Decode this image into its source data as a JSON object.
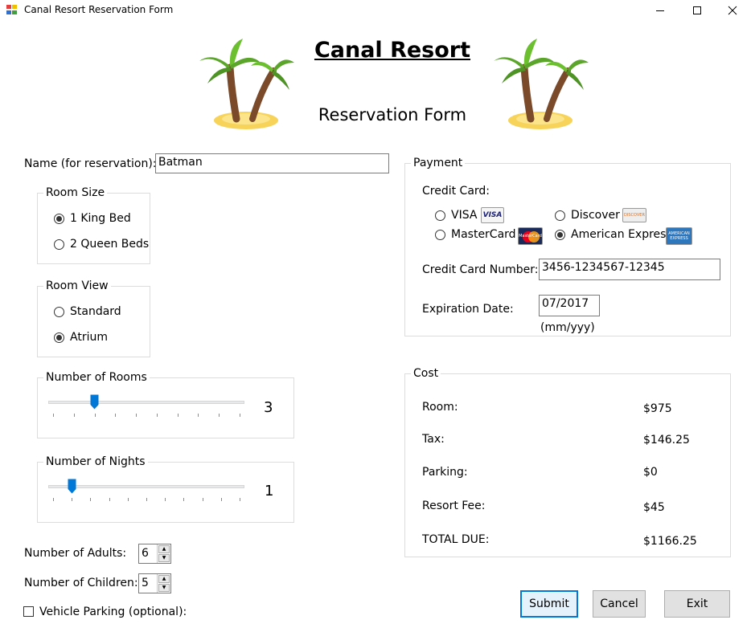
{
  "window": {
    "title": "Canal Resort Reservation Form"
  },
  "header": {
    "title": "Canal Resort",
    "subtitle": "Reservation Form"
  },
  "name_field": {
    "label": "Name (for reservation):",
    "value": "Batman"
  },
  "room_size": {
    "legend": "Room Size",
    "options": [
      {
        "label": "1 King Bed",
        "checked": true
      },
      {
        "label": "2 Queen Beds",
        "checked": false
      }
    ]
  },
  "room_view": {
    "legend": "Room View",
    "options": [
      {
        "label": "Standard",
        "checked": false
      },
      {
        "label": "Atrium",
        "checked": true
      }
    ]
  },
  "rooms": {
    "legend": "Number of Rooms",
    "value": "3",
    "min": 1,
    "max": 10
  },
  "nights": {
    "legend": "Number of Nights",
    "value": "1",
    "min": 0,
    "max": 10
  },
  "adults": {
    "label": "Number of Adults:",
    "value": "6"
  },
  "children": {
    "label": "Number of Children:",
    "value": "5"
  },
  "parking_option": {
    "label": "Vehicle Parking (optional):",
    "checked": false
  },
  "payment": {
    "legend": "Payment",
    "card_label": "Credit Card:",
    "cards": [
      {
        "label": "VISA",
        "logo": "VISA",
        "checked": false
      },
      {
        "label": "Discover",
        "logo": "DISCOVER",
        "checked": false
      },
      {
        "label": "MasterCard",
        "logo": "MasterCard",
        "checked": false
      },
      {
        "label": "American Express",
        "logo": "AMERICAN EXPRESS",
        "checked": true
      }
    ],
    "number_label": "Credit Card Number:",
    "number_value": "3456-1234567-12345",
    "expiration_label": "Expiration Date:",
    "expiration_value": "07/2017",
    "expiration_hint": "(mm/yyy)"
  },
  "cost": {
    "legend": "Cost",
    "rows": [
      {
        "label": "Room:",
        "value": "$975"
      },
      {
        "label": "Tax:",
        "value": "$146.25"
      },
      {
        "label": "Parking:",
        "value": "$0"
      },
      {
        "label": "Resort Fee:",
        "value": "$45"
      },
      {
        "label": "TOTAL DUE:",
        "value": "$1166.25"
      }
    ]
  },
  "buttons": {
    "submit": "Submit",
    "cancel": "Cancel",
    "exit": "Exit"
  },
  "colors": {
    "accent": "#0078d7",
    "group_border": "#dcdcdc",
    "button_face": "#e1e1e1"
  }
}
